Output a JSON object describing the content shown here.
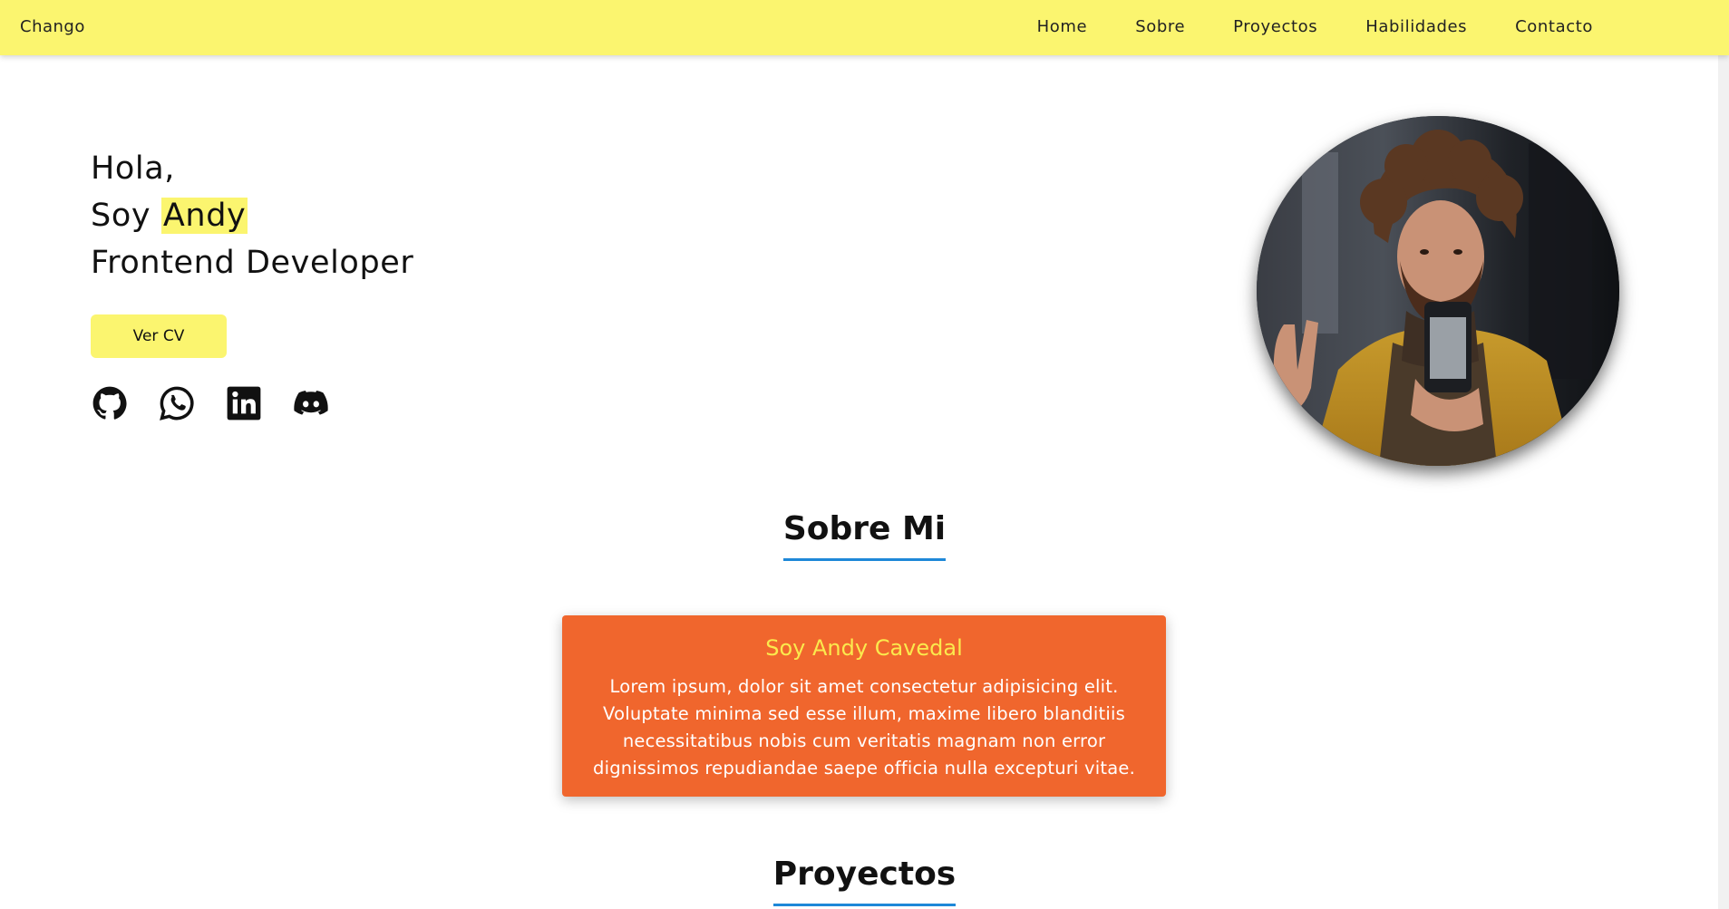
{
  "navbar": {
    "brand": "Chango",
    "links": [
      "Home",
      "Sobre",
      "Proyectos",
      "Habilidades",
      "Contacto"
    ]
  },
  "hero": {
    "greeting": "Hola,",
    "intro_prefix": "Soy",
    "name": "Andy",
    "role": "Frontend Developer",
    "cv_button": "Ver CV",
    "socials": [
      "github-icon",
      "whatsapp-icon",
      "linkedin-icon",
      "discord-icon"
    ]
  },
  "about": {
    "title": "Sobre Mi",
    "card_title": "Soy Andy Cavedal",
    "card_text": "Lorem ipsum, dolor sit amet consectetur adipisicing elit. Voluptate minima sed esse illum, maxime libero blanditiis necessitatibus nobis cum veritatis magnam non error dignissimos repudiandae saepe officia nulla excepturi vitae."
  },
  "projects": {
    "title": "Proyectos"
  },
  "colors": {
    "accent_yellow": "#fbf56f",
    "card_orange": "#f0662d",
    "card_title_yellow": "#fbe94d",
    "underline_blue": "#1e88d8"
  }
}
